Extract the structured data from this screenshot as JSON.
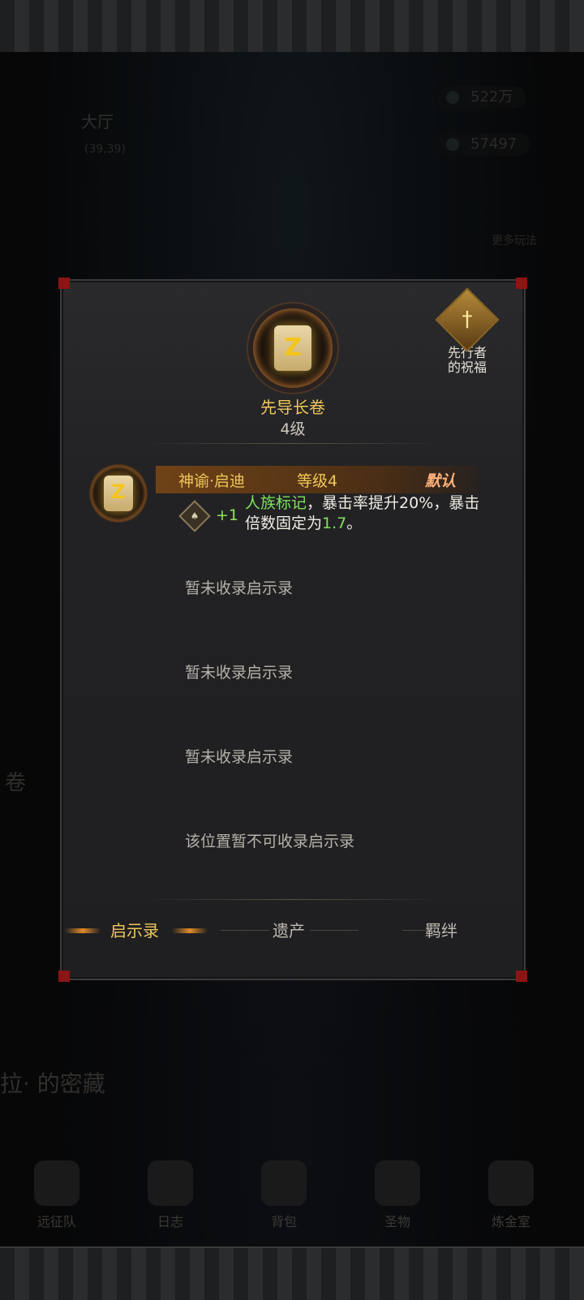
{
  "background": {
    "location_name": "大厅",
    "coords": "(39,39)",
    "resource1": "522万",
    "resource2": "57497",
    "more_play": "更多玩法",
    "side_text": "卷",
    "bottom_banner": "拉·  的密藏",
    "nav": [
      "远征队",
      "日志",
      "背包",
      "圣物",
      "炼金室"
    ]
  },
  "modal": {
    "title": "先导长卷",
    "level": "4级",
    "blessing_label": "先行者\n的祝福",
    "scroll_glyph": "Z",
    "revelation": {
      "name": "神谕·启迪",
      "level": "等级4",
      "default_tag": "默认",
      "plus": "+1",
      "desc_green": "人族标记",
      "desc_mid": "，暴击率提升20%，暴击倍数固定为",
      "desc_value": "1.7",
      "desc_end": "。"
    },
    "empty_slots": [
      "暂未收录启示录",
      "暂未收录启示录",
      "暂未收录启示录",
      "该位置暂不可收录启示录"
    ],
    "tabs": [
      "启示录",
      "遗产",
      "羁绊"
    ]
  },
  "colors": {
    "accent_gold": "#f0c75a",
    "green": "#7ee35a",
    "default_tag": "#ffb27a",
    "corner_red": "#8b1414"
  }
}
